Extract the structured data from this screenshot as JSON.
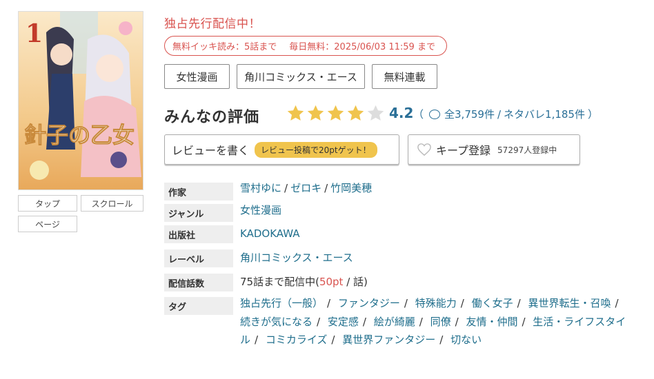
{
  "cover": {
    "volume": "1",
    "title_art": "針子の乙女"
  },
  "view_modes": [
    "タップ",
    "スクロール",
    "ページ"
  ],
  "headline": "独占先行配信中！",
  "free_info": {
    "part1": "無料イッキ読み：5話まで",
    "part2": "毎日無料：2025/06/03 11:59 まで"
  },
  "category_tags": [
    "女性漫画",
    "角川コミックス・エース",
    "無料連載"
  ],
  "rating": {
    "title": "みんなの評価",
    "score": "4.2",
    "stars_filled": 4,
    "stars_total": 5,
    "star_color": "#f0c44d",
    "star_empty_color": "#dddddd",
    "open_paren": "（",
    "reviews": "全3,759件",
    "slash": "/",
    "spoilers": "ネタバレ1,185件",
    "close_paren": "）"
  },
  "review_button": {
    "label": "レビューを書く",
    "promo": "レビュー投稿で20ptゲット！"
  },
  "keep_button": {
    "label": "キープ登録",
    "count": "57297人登録中"
  },
  "info": {
    "author_label": "作家",
    "authors": [
      "雪村ゆに",
      "ゼロキ",
      "竹岡美穂"
    ],
    "genre_label": "ジャンル",
    "genre": "女性漫画",
    "publisher_label": "出版社",
    "publisher": "KADOKAWA",
    "label_label": "レーベル",
    "label": "角川コミックス・エース",
    "episodes_label": "配信話数",
    "episodes_prefix": "75話まで配信中(",
    "episodes_price": "50pt",
    "episodes_suffix": " / 話)",
    "tags_label": "タグ"
  },
  "tags": [
    "独占先行（一般）",
    "ファンタジー",
    "特殊能力",
    "働く女子",
    "異世界転生・召喚",
    "続きが気になる",
    "安定感",
    "絵が綺麗",
    "同僚",
    "友情・仲間",
    "生活・ライフスタイル",
    "コミカライズ",
    "異世界ファンタジー",
    "切ない"
  ],
  "colors": {
    "accent_red": "#d9534f",
    "link_blue": "#1f6e8c",
    "score_blue": "#2a6f97"
  }
}
